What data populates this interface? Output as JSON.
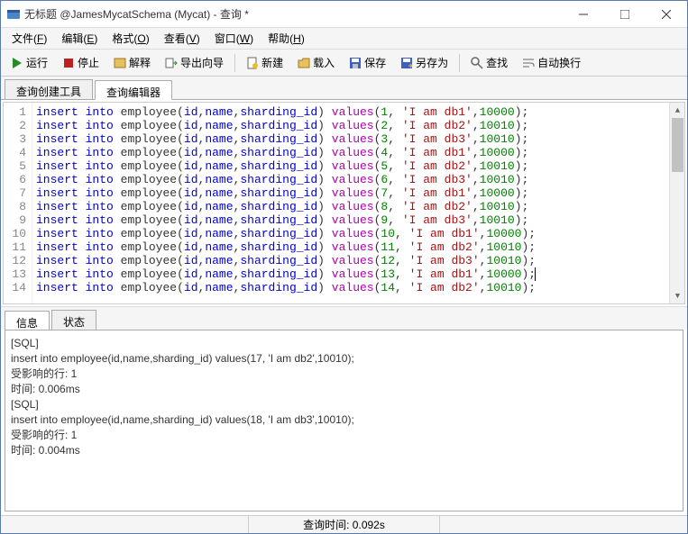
{
  "window": {
    "title": "无标题 @JamesMycatSchema (Mycat) - 查询 *"
  },
  "menu": {
    "file": "文件",
    "file_k": "F",
    "edit": "编辑",
    "edit_k": "E",
    "format": "格式",
    "format_k": "O",
    "view": "查看",
    "view_k": "V",
    "window": "窗口",
    "window_k": "W",
    "help": "帮助",
    "help_k": "H"
  },
  "toolbar": {
    "run": "运行",
    "stop": "停止",
    "explain": "解释",
    "export_wizard": "导出向导",
    "new": "新建",
    "load": "载入",
    "save": "保存",
    "save_as": "另存为",
    "find": "查找",
    "wrap": "自动换行"
  },
  "top_tabs": {
    "builder": "查询创建工具",
    "editor": "查询编辑器"
  },
  "bottom_tabs": {
    "info": "信息",
    "state": "状态"
  },
  "code_lines": [
    {
      "n": 1,
      "args": "1, 'I am db1',10000"
    },
    {
      "n": 2,
      "args": "2, 'I am db2',10010"
    },
    {
      "n": 3,
      "args": "3, 'I am db3',10010"
    },
    {
      "n": 4,
      "args": "4, 'I am db1',10000"
    },
    {
      "n": 5,
      "args": "5, 'I am db2',10010"
    },
    {
      "n": 6,
      "args": "6, 'I am db3',10010"
    },
    {
      "n": 7,
      "args": "7, 'I am db1',10000"
    },
    {
      "n": 8,
      "args": "8, 'I am db2',10010"
    },
    {
      "n": 9,
      "args": "9, 'I am db3',10010"
    },
    {
      "n": 10,
      "args": "10, 'I am db1',10000"
    },
    {
      "n": 11,
      "args": "11, 'I am db2',10010"
    },
    {
      "n": 12,
      "args": "12, 'I am db3',10010"
    },
    {
      "n": 13,
      "args": "13, 'I am db1',10000",
      "cursor": true
    },
    {
      "n": 14,
      "args": "14, 'I am db2',10010"
    }
  ],
  "sql_parts": {
    "insert": "insert",
    "into": "into",
    "table": "employee",
    "cols_open": "(",
    "col_id": "id",
    "col_name": "name",
    "col_shard": "sharding_id",
    "cols_close": ")",
    "values": "values",
    "comma": ",",
    "semi": ";"
  },
  "output": {
    "hdr1": "[SQL]",
    "sql1": "insert into employee(id,name,sharding_id) values(17, 'I am db2',10010);",
    "aff1": "受影响的行: 1",
    "time1": "时间: 0.006ms",
    "blank": "",
    "hdr2": "[SQL]",
    "sql2": "insert into employee(id,name,sharding_id) values(18, 'I am db3',10010);",
    "aff2": "受影响的行: 1",
    "time2": "时间: 0.004ms"
  },
  "status": {
    "query_time": "查询时间: 0.092s"
  }
}
